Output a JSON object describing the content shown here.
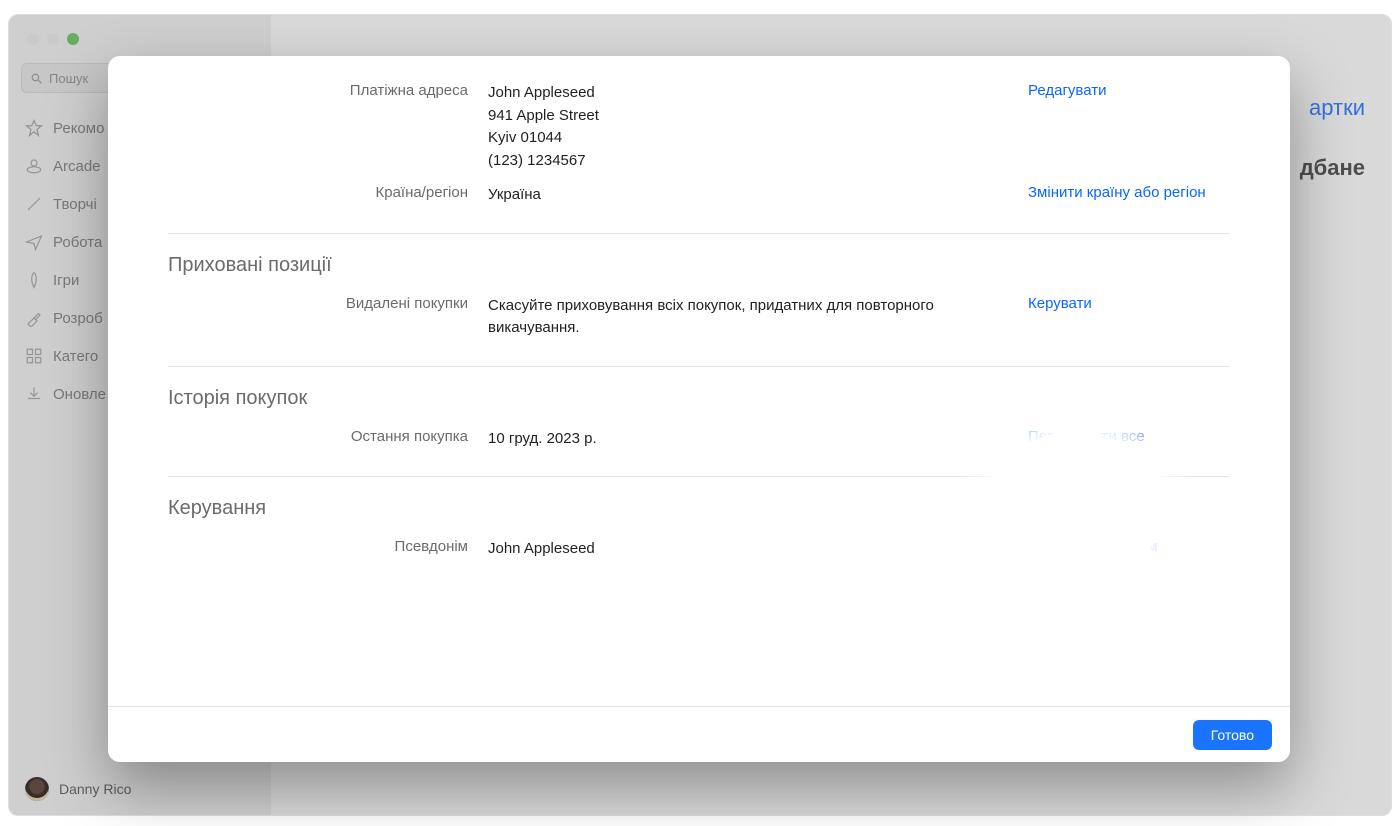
{
  "window": {
    "search_placeholder": "Пошук",
    "nav": [
      {
        "icon": "star",
        "label": "Рекомо"
      },
      {
        "icon": "arcade",
        "label": "Arcade"
      },
      {
        "icon": "brush",
        "label": "Творчі"
      },
      {
        "icon": "plane",
        "label": "Робота"
      },
      {
        "icon": "rocket",
        "label": "Ігри"
      },
      {
        "icon": "hammer",
        "label": "Розроб"
      },
      {
        "icon": "grid",
        "label": "Катего"
      },
      {
        "icon": "download",
        "label": "Оновле"
      }
    ],
    "user_name": "Danny Rico",
    "bg_link": "артки",
    "bg_sub": "дбане"
  },
  "modal": {
    "billing_label": "Платіжна адреса",
    "billing_name": "John Appleseed",
    "billing_street": "941 Apple Street",
    "billing_city": "Kyiv 01044",
    "billing_phone": "(123) 1234567",
    "billing_action": "Редагувати",
    "country_label": "Країна/регіон",
    "country_value": "Україна",
    "country_action": "Змінити країну або регіон",
    "hidden_title": "Приховані позиції",
    "hidden_label": "Видалені покупки",
    "hidden_value": "Скасуйте приховування всіх покупок, придатних для повторного викачування.",
    "hidden_action": "Керувати",
    "history_title": "Історія покупок",
    "history_label": "Остання покупка",
    "history_value": "10 груд. 2023 р.",
    "history_action": "Переглянути все",
    "manage_title": "Керування",
    "nickname_label": "Псевдонім",
    "nickname_value": "John Appleseed",
    "nickname_action": "Змінити псевдонім",
    "done": "Готово"
  }
}
